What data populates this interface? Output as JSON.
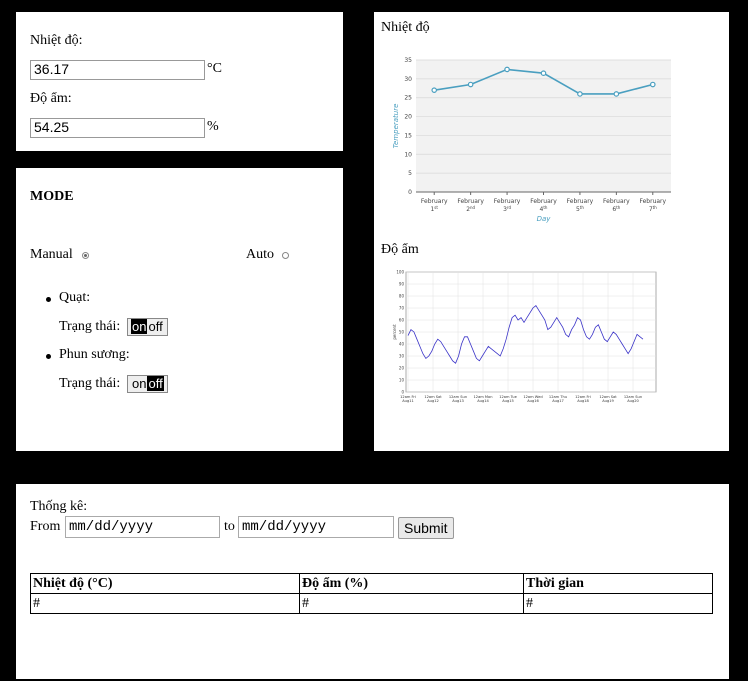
{
  "sensor": {
    "temp_label": "Nhiệt độ:",
    "temp_value": "36.17",
    "temp_unit": "°C",
    "hum_label": "Độ ẩm:",
    "hum_value": "54.25",
    "hum_unit": "%"
  },
  "mode": {
    "title": "MODE",
    "manual_label": "Manual",
    "manual_selected": true,
    "auto_label": "Auto",
    "auto_selected": false,
    "devices": [
      {
        "name": "Quạt:",
        "status_label": "Trạng thái:",
        "on": "on",
        "off": "off",
        "state": "on"
      },
      {
        "name": "Phun sương:",
        "status_label": "Trạng thái:",
        "on": "on",
        "off": "off",
        "state": "off"
      }
    ]
  },
  "charts": {
    "temp_title": "Nhiệt độ",
    "hum_title": "Độ ẩm"
  },
  "chart_data": [
    {
      "type": "line",
      "title": "",
      "xlabel": "Day",
      "ylabel": "Temperature",
      "categories": [
        "February 1st",
        "February 2nd",
        "February 3rd",
        "February 4th",
        "February 5th",
        "February 6th",
        "February 7th"
      ],
      "category_lines": [
        [
          "February",
          "1",
          "st"
        ],
        [
          "February",
          "2",
          "nd"
        ],
        [
          "February",
          "3",
          "rd"
        ],
        [
          "February",
          "4",
          "th"
        ],
        [
          "February",
          "5",
          "th"
        ],
        [
          "February",
          "6",
          "th"
        ],
        [
          "February",
          "7",
          "th"
        ]
      ],
      "values": [
        27,
        28.5,
        32.5,
        31.5,
        26,
        26,
        28.5
      ],
      "ylim": [
        0,
        35
      ],
      "yticks": [
        0,
        5,
        10,
        15,
        20,
        25,
        30,
        35
      ],
      "grid": true,
      "color": "#4a9fc0"
    },
    {
      "type": "line",
      "title": "",
      "xlabel": "",
      "ylabel": "percent",
      "ylim": [
        0,
        100
      ],
      "yticks": [
        0,
        10,
        20,
        30,
        40,
        50,
        60,
        70,
        80,
        90,
        100
      ],
      "x_ticks": [
        [
          "12am Fri",
          "Aug11"
        ],
        [
          "12am Sat",
          "Aug12"
        ],
        [
          "12am Sun",
          "Aug13"
        ],
        [
          "12am Mon",
          "Aug14"
        ],
        [
          "12am Tue",
          "Aug15"
        ],
        [
          "12am Wed",
          "Aug16"
        ],
        [
          "12am Thu",
          "Aug17"
        ],
        [
          "12am Fri",
          "Aug18"
        ],
        [
          "12am Sat",
          "Aug19"
        ],
        [
          "12am Sun",
          "Aug20"
        ]
      ],
      "values": [
        47,
        52,
        50,
        44,
        38,
        32,
        28,
        30,
        34,
        40,
        44,
        42,
        38,
        34,
        30,
        26,
        24,
        30,
        40,
        46,
        46,
        40,
        34,
        28,
        26,
        30,
        34,
        38,
        36,
        34,
        32,
        30,
        36,
        44,
        54,
        62,
        64,
        60,
        62,
        58,
        62,
        66,
        70,
        72,
        68,
        64,
        60,
        52,
        54,
        58,
        62,
        58,
        54,
        48,
        46,
        52,
        56,
        62,
        60,
        52,
        46,
        44,
        48,
        54,
        56,
        50,
        44,
        42,
        46,
        50,
        48,
        44,
        40,
        36,
        32,
        36,
        42,
        48,
        46,
        44
      ],
      "grid": true,
      "color": "#3a33c8"
    }
  ],
  "stats": {
    "title": "Thống kê:",
    "from_label": "From",
    "to_label": "to",
    "from_placeholder": "mm/dd/yyyy",
    "to_placeholder": "mm/dd/yyyy",
    "submit": "Submit",
    "columns": [
      "Nhiệt độ (°C)",
      "Độ ẩm (%)",
      "Thời gian"
    ],
    "rows": [
      [
        "#",
        "#",
        "#"
      ]
    ]
  }
}
